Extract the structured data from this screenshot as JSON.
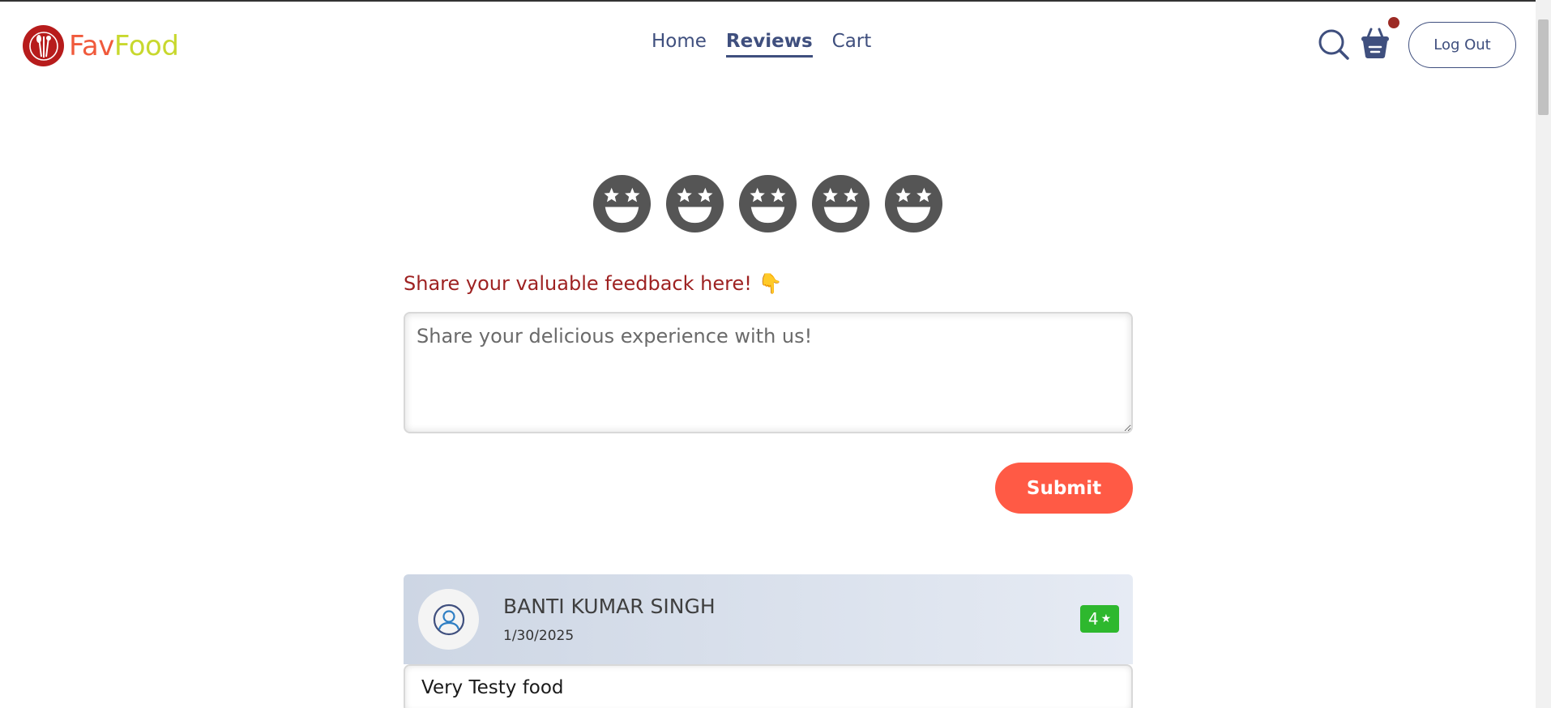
{
  "brand": {
    "part1": "Fav",
    "part2": "Food"
  },
  "nav": {
    "items": [
      {
        "label": "Home",
        "active": false
      },
      {
        "label": "Reviews",
        "active": true
      },
      {
        "label": "Cart",
        "active": false
      }
    ]
  },
  "header": {
    "search_icon": "search-icon",
    "cart_icon": "basket-icon",
    "logout_label": "Log Out"
  },
  "rating_emojis": [
    "star-eyes-emoji",
    "star-eyes-emoji",
    "star-eyes-emoji",
    "star-eyes-emoji",
    "star-eyes-emoji"
  ],
  "feedback": {
    "label": "Share your valuable feedback here! 👇",
    "placeholder": "Share your delicious experience with us!",
    "submit_label": "Submit"
  },
  "reviews": [
    {
      "name": "BANTI KUMAR SINGH",
      "date": "1/30/2025",
      "rating": "4",
      "text": "Very Testy food"
    }
  ],
  "colors": {
    "nav": "#3f4f7e",
    "accent": "#ff5a45",
    "feedback_label": "#9e2222",
    "rating_badge": "#2eb82e"
  }
}
